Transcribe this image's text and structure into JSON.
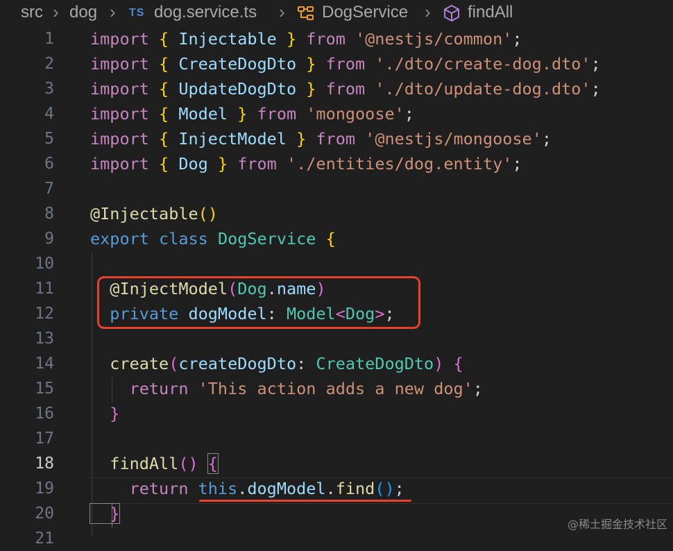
{
  "breadcrumb": {
    "segments": [
      "src",
      "dog",
      "dog.service.ts",
      "DogService",
      "findAll"
    ],
    "file_badge": "TS",
    "icons": [
      "chevron-right-icon",
      "class-symbol-icon",
      "method-symbol-icon"
    ]
  },
  "editor": {
    "language": "TypeScript",
    "active_line": "18",
    "line_numbers": [
      "1",
      "2",
      "3",
      "4",
      "5",
      "6",
      "7",
      "8",
      "9",
      "10",
      "11",
      "12",
      "13",
      "14",
      "15",
      "16",
      "17",
      "18",
      "19",
      "20",
      "21"
    ],
    "lines": [
      [
        [
          "import ",
          "import"
        ],
        [
          "{ ",
          "brace"
        ],
        [
          "Injectable",
          "var"
        ],
        [
          " }",
          "brace"
        ],
        [
          " from ",
          "import"
        ],
        [
          "'@nestjs/common'",
          "str"
        ],
        [
          ";",
          "plain"
        ]
      ],
      [
        [
          "import ",
          "import"
        ],
        [
          "{ ",
          "brace"
        ],
        [
          "CreateDogDto",
          "var"
        ],
        [
          " }",
          "brace"
        ],
        [
          " from ",
          "import"
        ],
        [
          "'./dto/create-dog.dto'",
          "str"
        ],
        [
          ";",
          "plain"
        ]
      ],
      [
        [
          "import ",
          "import"
        ],
        [
          "{ ",
          "brace"
        ],
        [
          "UpdateDogDto",
          "var"
        ],
        [
          " }",
          "brace"
        ],
        [
          " from ",
          "import"
        ],
        [
          "'./dto/update-dog.dto'",
          "str"
        ],
        [
          ";",
          "plain"
        ]
      ],
      [
        [
          "import ",
          "import"
        ],
        [
          "{ ",
          "brace"
        ],
        [
          "Model",
          "var"
        ],
        [
          " }",
          "brace"
        ],
        [
          " from ",
          "import"
        ],
        [
          "'mongoose'",
          "str"
        ],
        [
          ";",
          "plain"
        ]
      ],
      [
        [
          "import ",
          "import"
        ],
        [
          "{ ",
          "brace"
        ],
        [
          "InjectModel",
          "var"
        ],
        [
          " }",
          "brace"
        ],
        [
          " from ",
          "import"
        ],
        [
          "'@nestjs/mongoose'",
          "str"
        ],
        [
          ";",
          "plain"
        ]
      ],
      [
        [
          "import ",
          "import"
        ],
        [
          "{ ",
          "brace"
        ],
        [
          "Dog",
          "var"
        ],
        [
          " }",
          "brace"
        ],
        [
          " from ",
          "import"
        ],
        [
          "'./entities/dog.entity'",
          "str"
        ],
        [
          ";",
          "plain"
        ]
      ],
      [],
      [
        [
          "@",
          "fn"
        ],
        [
          "Injectable",
          "fn"
        ],
        [
          "()",
          "brace"
        ]
      ],
      [
        [
          "export ",
          "blue"
        ],
        [
          "class ",
          "blue"
        ],
        [
          "DogService",
          "type"
        ],
        [
          " {",
          "brace"
        ]
      ],
      [],
      [
        [
          "  @",
          "fn"
        ],
        [
          "InjectModel",
          "fn"
        ],
        [
          "(",
          "paren"
        ],
        [
          "Dog",
          "type"
        ],
        [
          ".",
          "plain"
        ],
        [
          "name",
          "var"
        ],
        [
          ")",
          "paren"
        ]
      ],
      [
        [
          "  private ",
          "blue"
        ],
        [
          "dogModel",
          "var"
        ],
        [
          ": ",
          "plain"
        ],
        [
          "Model",
          "type"
        ],
        [
          "<",
          "paren"
        ],
        [
          "Dog",
          "type"
        ],
        [
          ">",
          "paren"
        ],
        [
          ";",
          "plain"
        ]
      ],
      [],
      [
        [
          "  create",
          "fn"
        ],
        [
          "(",
          "paren"
        ],
        [
          "createDogDto",
          "var"
        ],
        [
          ": ",
          "plain"
        ],
        [
          "CreateDogDto",
          "type"
        ],
        [
          ")",
          "paren"
        ],
        [
          " {",
          "paren"
        ]
      ],
      [
        [
          "    return ",
          "import"
        ],
        [
          "'This action adds a new dog'",
          "str"
        ],
        [
          ";",
          "plain"
        ]
      ],
      [
        [
          "  }",
          "paren"
        ]
      ],
      [],
      [
        [
          "  findAll",
          "fn"
        ],
        [
          "()",
          "paren"
        ],
        [
          " ",
          "plain"
        ],
        [
          "{",
          "paren"
        ]
      ],
      [
        [
          "    return ",
          "import"
        ],
        [
          "this",
          "blue"
        ],
        [
          ".",
          "plain"
        ],
        [
          "dogModel",
          "var"
        ],
        [
          ".",
          "plain"
        ],
        [
          "find",
          "fn"
        ],
        [
          "()",
          "paren2"
        ],
        [
          ";",
          "plain"
        ]
      ],
      [
        [
          "  }",
          "paren"
        ]
      ],
      []
    ]
  },
  "annotations": {
    "box_color": "#e8412d",
    "underline_color": "#e8412d"
  },
  "watermark": "@稀土掘金技术社区"
}
